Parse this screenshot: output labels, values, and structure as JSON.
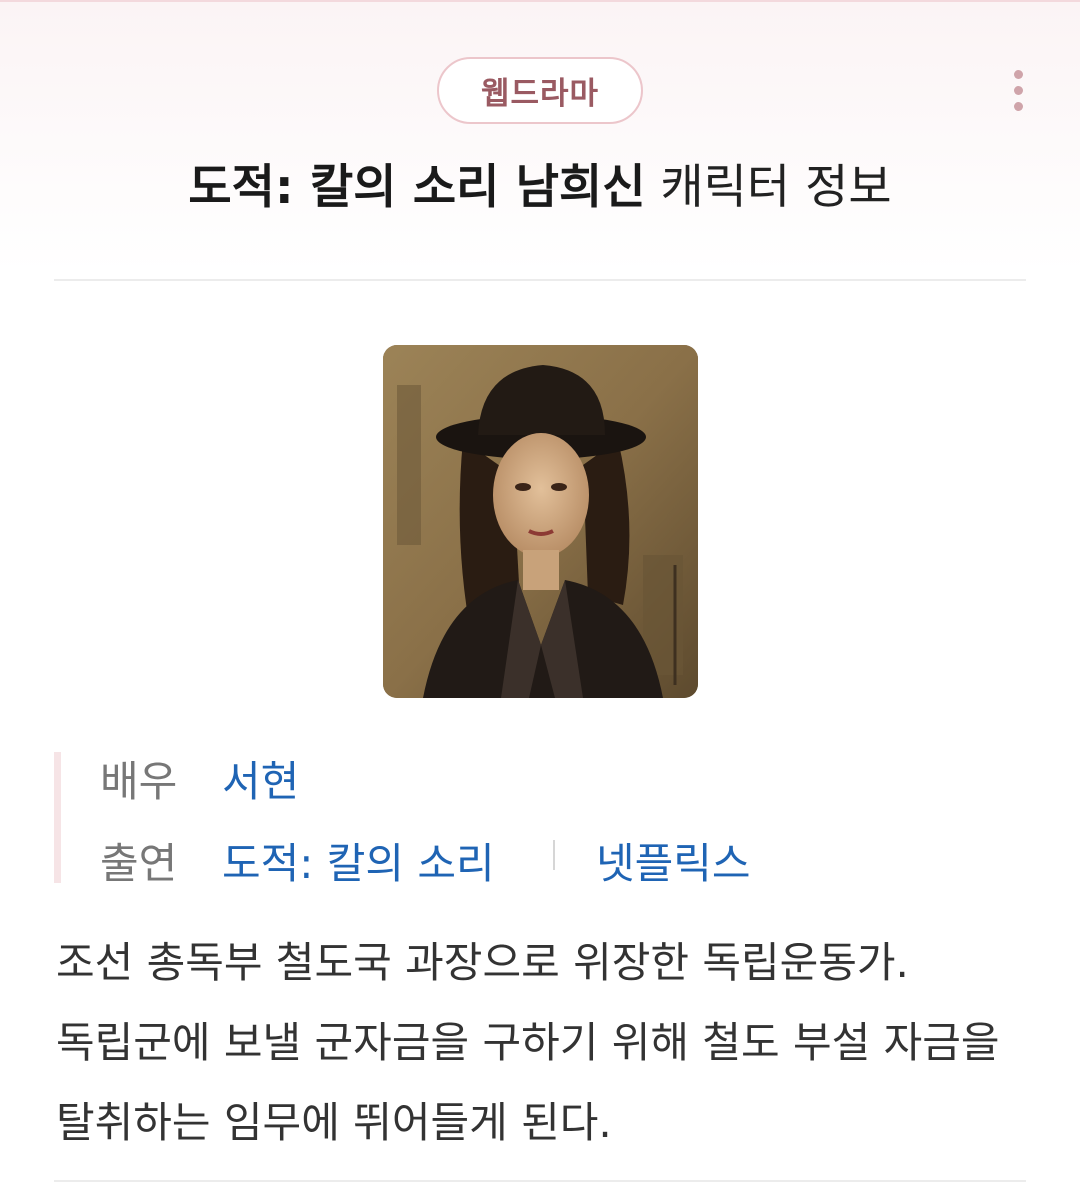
{
  "header": {
    "category_badge": "웹드라마",
    "title_name": "도적: 칼의 소리 남희신",
    "title_suffix": "캐릭터 정보",
    "more_icon": "more-vertical-icon"
  },
  "info": {
    "actor_label": "배우",
    "actor_name": "서현",
    "cast_label": "출연",
    "cast_title": "도적: 칼의 소리",
    "cast_platform": "넷플릭스"
  },
  "description": "조선 총독부 철도국 과장으로 위장한 독립운동가. 독립군에 보낼 군자금을 구하기 위해 철도 부설 자금을 탈취하는 임무에 뛰어들게 된다.",
  "colors": {
    "accent_badge": "#9a5a62",
    "link": "#1f64b4",
    "label": "#777777"
  }
}
